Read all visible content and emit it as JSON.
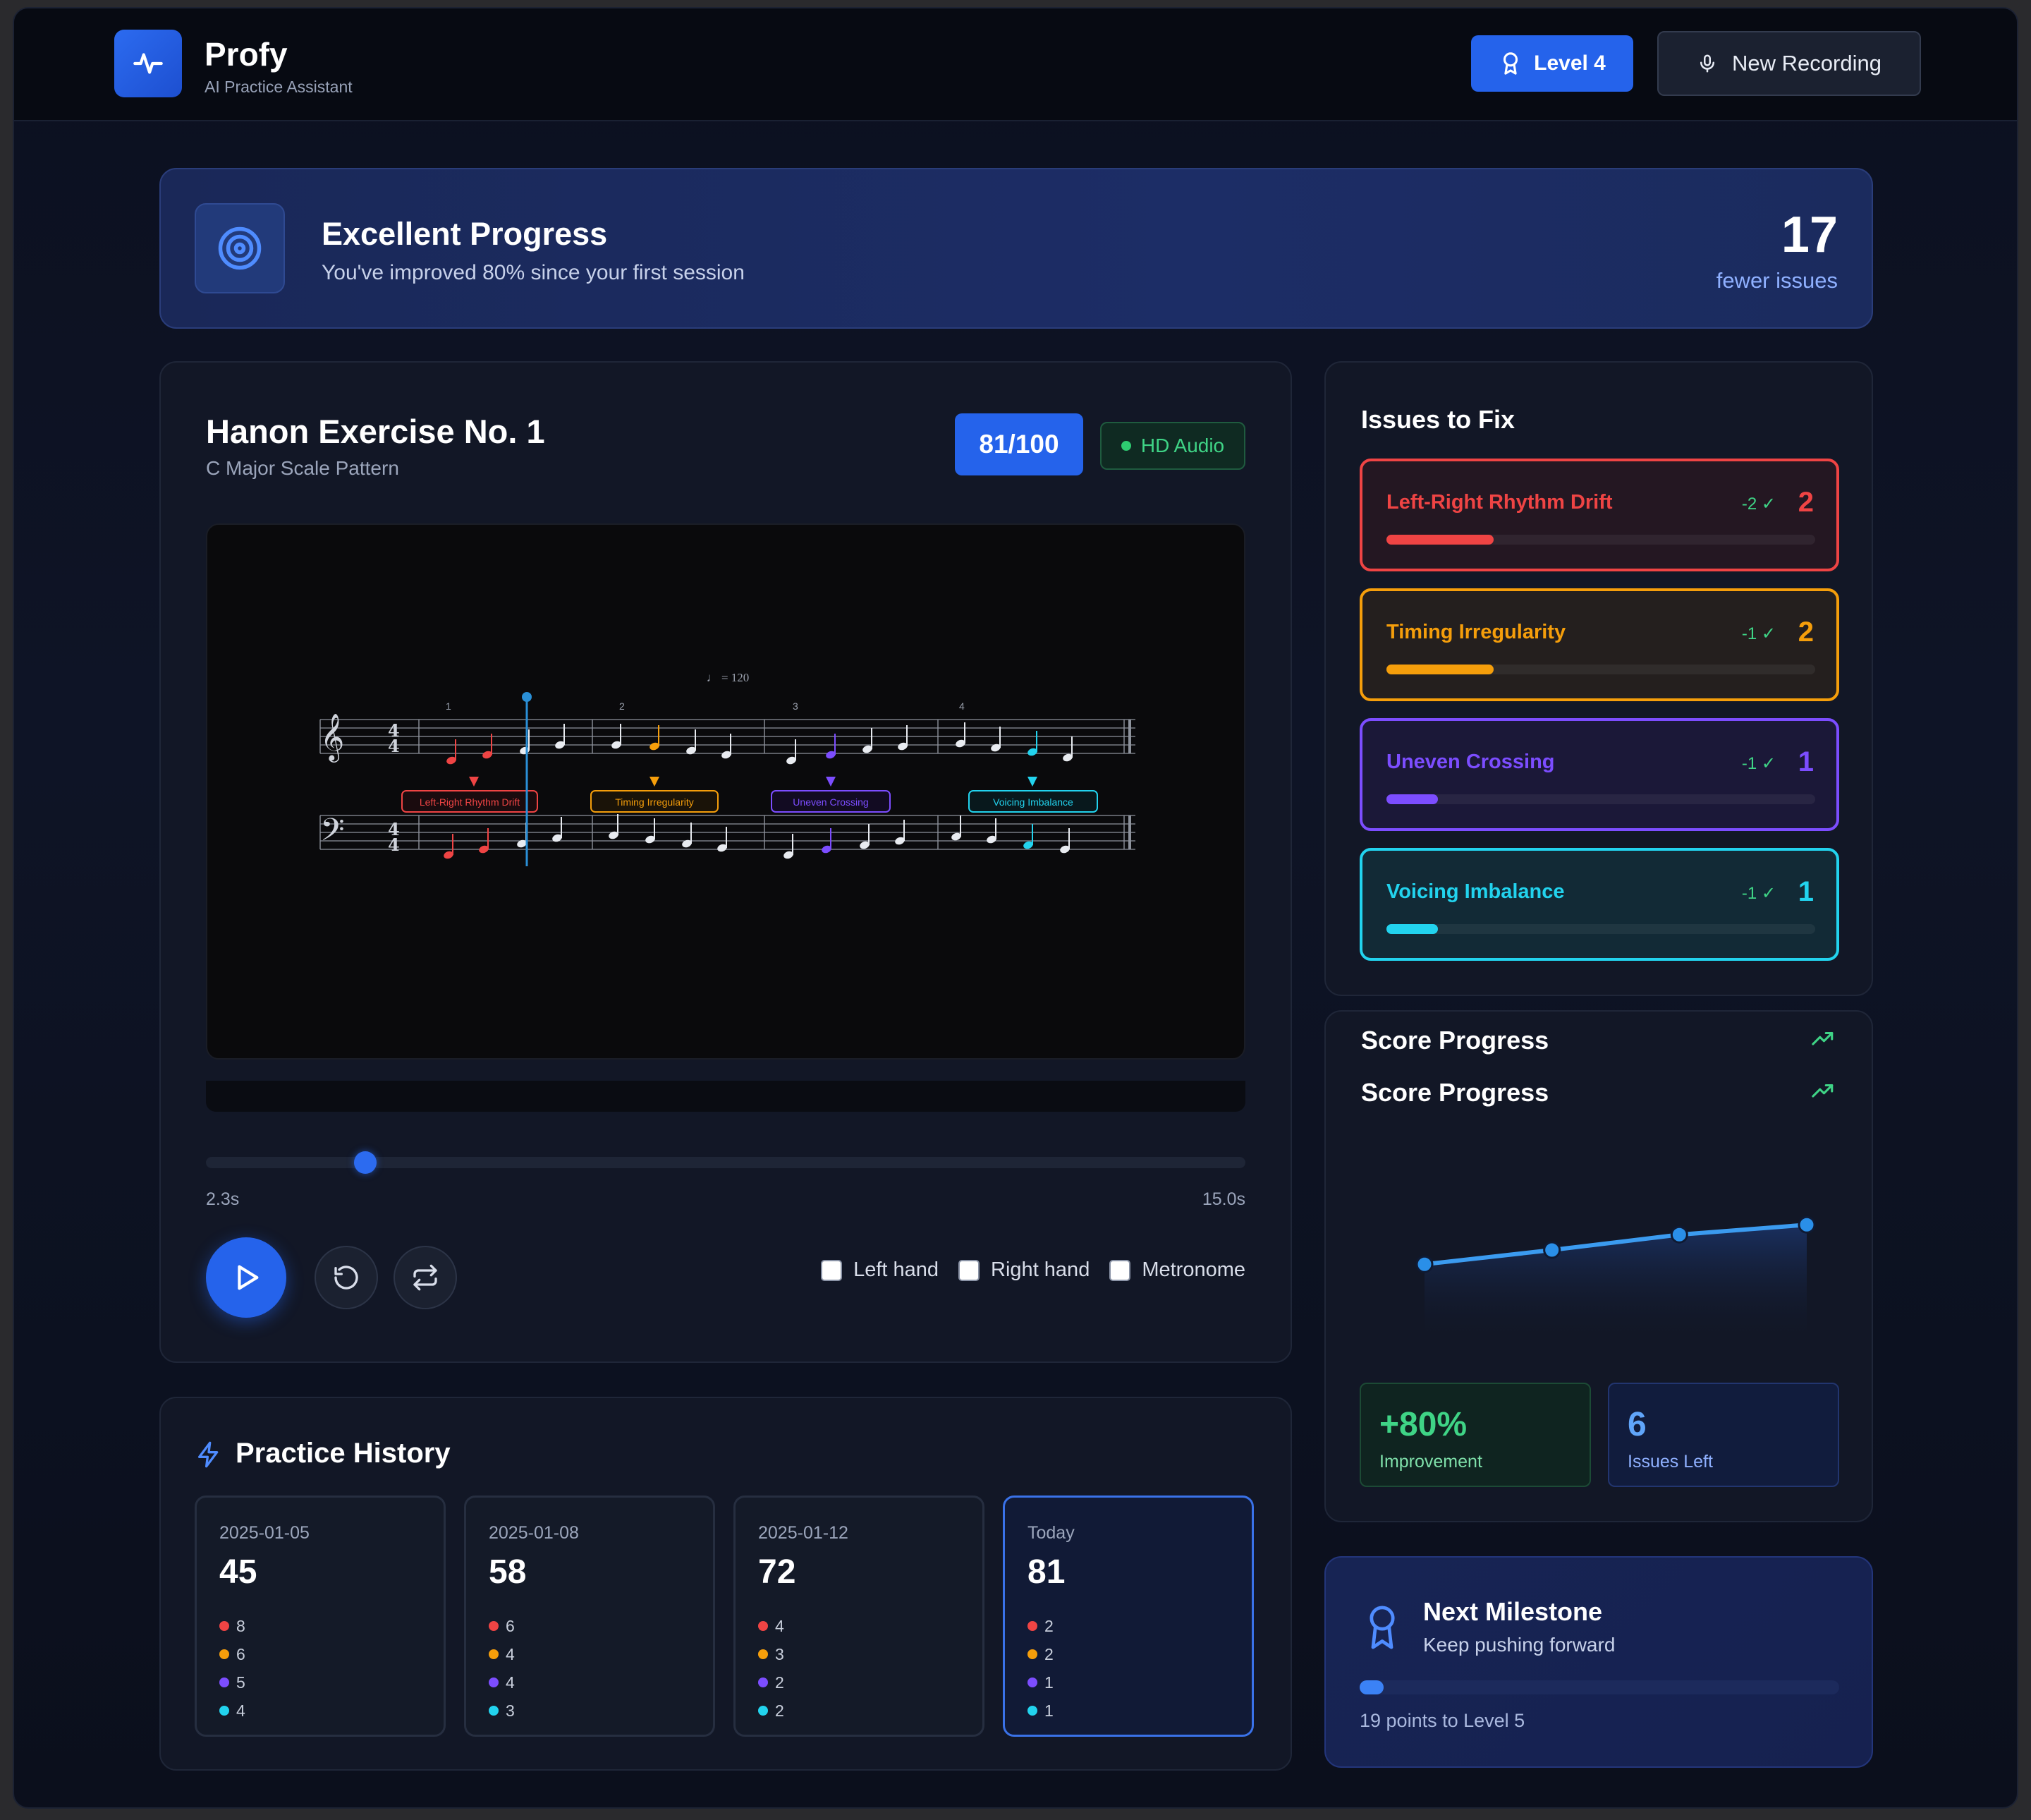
{
  "app": {
    "title": "Profy",
    "subtitle": "AI Practice Assistant"
  },
  "header": {
    "level_label": "Level 4",
    "record_label": "New Recording"
  },
  "banner": {
    "title": "Excellent Progress",
    "subtitle": "You've improved 80% since your first session",
    "value": "17",
    "value_label": "fewer issues"
  },
  "exercise": {
    "title": "Hanon Exercise No. 1",
    "subtitle": "C Major Scale Pattern",
    "score": "81/100",
    "audio_badge": "HD Audio",
    "tempo": "♩ = 120",
    "measures": [
      "1",
      "2",
      "3",
      "4"
    ],
    "annotations": [
      "Left-Right Rhythm Drift",
      "Timing Irregularity",
      "Uneven Crossing",
      "Voicing Imbalance"
    ],
    "time_current": "2.3s",
    "time_total": "15.0s",
    "playback_fraction": 0.153,
    "toggles": [
      "Left hand",
      "Right hand",
      "Metronome"
    ]
  },
  "issues": {
    "title": "Issues to Fix",
    "items": [
      {
        "name": "Left-Right Rhythm Drift",
        "delta": "-2 ✓",
        "count": "2",
        "color": "#ef4444",
        "bg": "#241722",
        "fill": 0.25
      },
      {
        "name": "Timing Irregularity",
        "delta": "-1 ✓",
        "count": "2",
        "color": "#f59e0b",
        "bg": "#241f1e",
        "fill": 0.25
      },
      {
        "name": "Uneven Crossing",
        "delta": "-1 ✓",
        "count": "1",
        "color": "#7c4dff",
        "bg": "#1b1838",
        "fill": 0.12
      },
      {
        "name": "Voicing Imbalance",
        "delta": "-1 ✓",
        "count": "1",
        "color": "#22d3ee",
        "bg": "#122a36",
        "fill": 0.12
      }
    ]
  },
  "score_progress": {
    "title": "Score Progress",
    "improvement": "+80%",
    "improvement_label": "Improvement",
    "issues_left": "6",
    "issues_left_label": "Issues Left"
  },
  "chart_data": {
    "type": "line",
    "x": [
      "2025-01-05",
      "2025-01-08",
      "2025-01-12",
      "Today"
    ],
    "values": [
      45,
      58,
      72,
      81
    ],
    "ylim": [
      0,
      100
    ]
  },
  "milestone": {
    "title": "Next Milestone",
    "subtitle": "Keep pushing forward",
    "progress_fraction": 0.05,
    "note": "19 points to Level 5"
  },
  "history": {
    "title": "Practice History",
    "sessions": [
      {
        "date": "2025-01-05",
        "score": "45",
        "issues": [
          "8",
          "6",
          "5",
          "4"
        ]
      },
      {
        "date": "2025-01-08",
        "score": "58",
        "issues": [
          "6",
          "4",
          "4",
          "3"
        ]
      },
      {
        "date": "2025-01-12",
        "score": "72",
        "issues": [
          "4",
          "3",
          "2",
          "2"
        ]
      },
      {
        "date": "Today",
        "score": "81",
        "issues": [
          "2",
          "2",
          "1",
          "1"
        ]
      }
    ],
    "issue_colors": [
      "#ef4444",
      "#f59e0b",
      "#7c4dff",
      "#22d3ee"
    ]
  },
  "colors": {
    "accent": "#2563eb",
    "success": "#3fd486"
  },
  "icons": [
    "activity-icon",
    "award-icon",
    "mic-icon",
    "target-icon",
    "play-icon",
    "restart-icon",
    "repeat-icon",
    "trending-up-icon",
    "zap-icon"
  ]
}
